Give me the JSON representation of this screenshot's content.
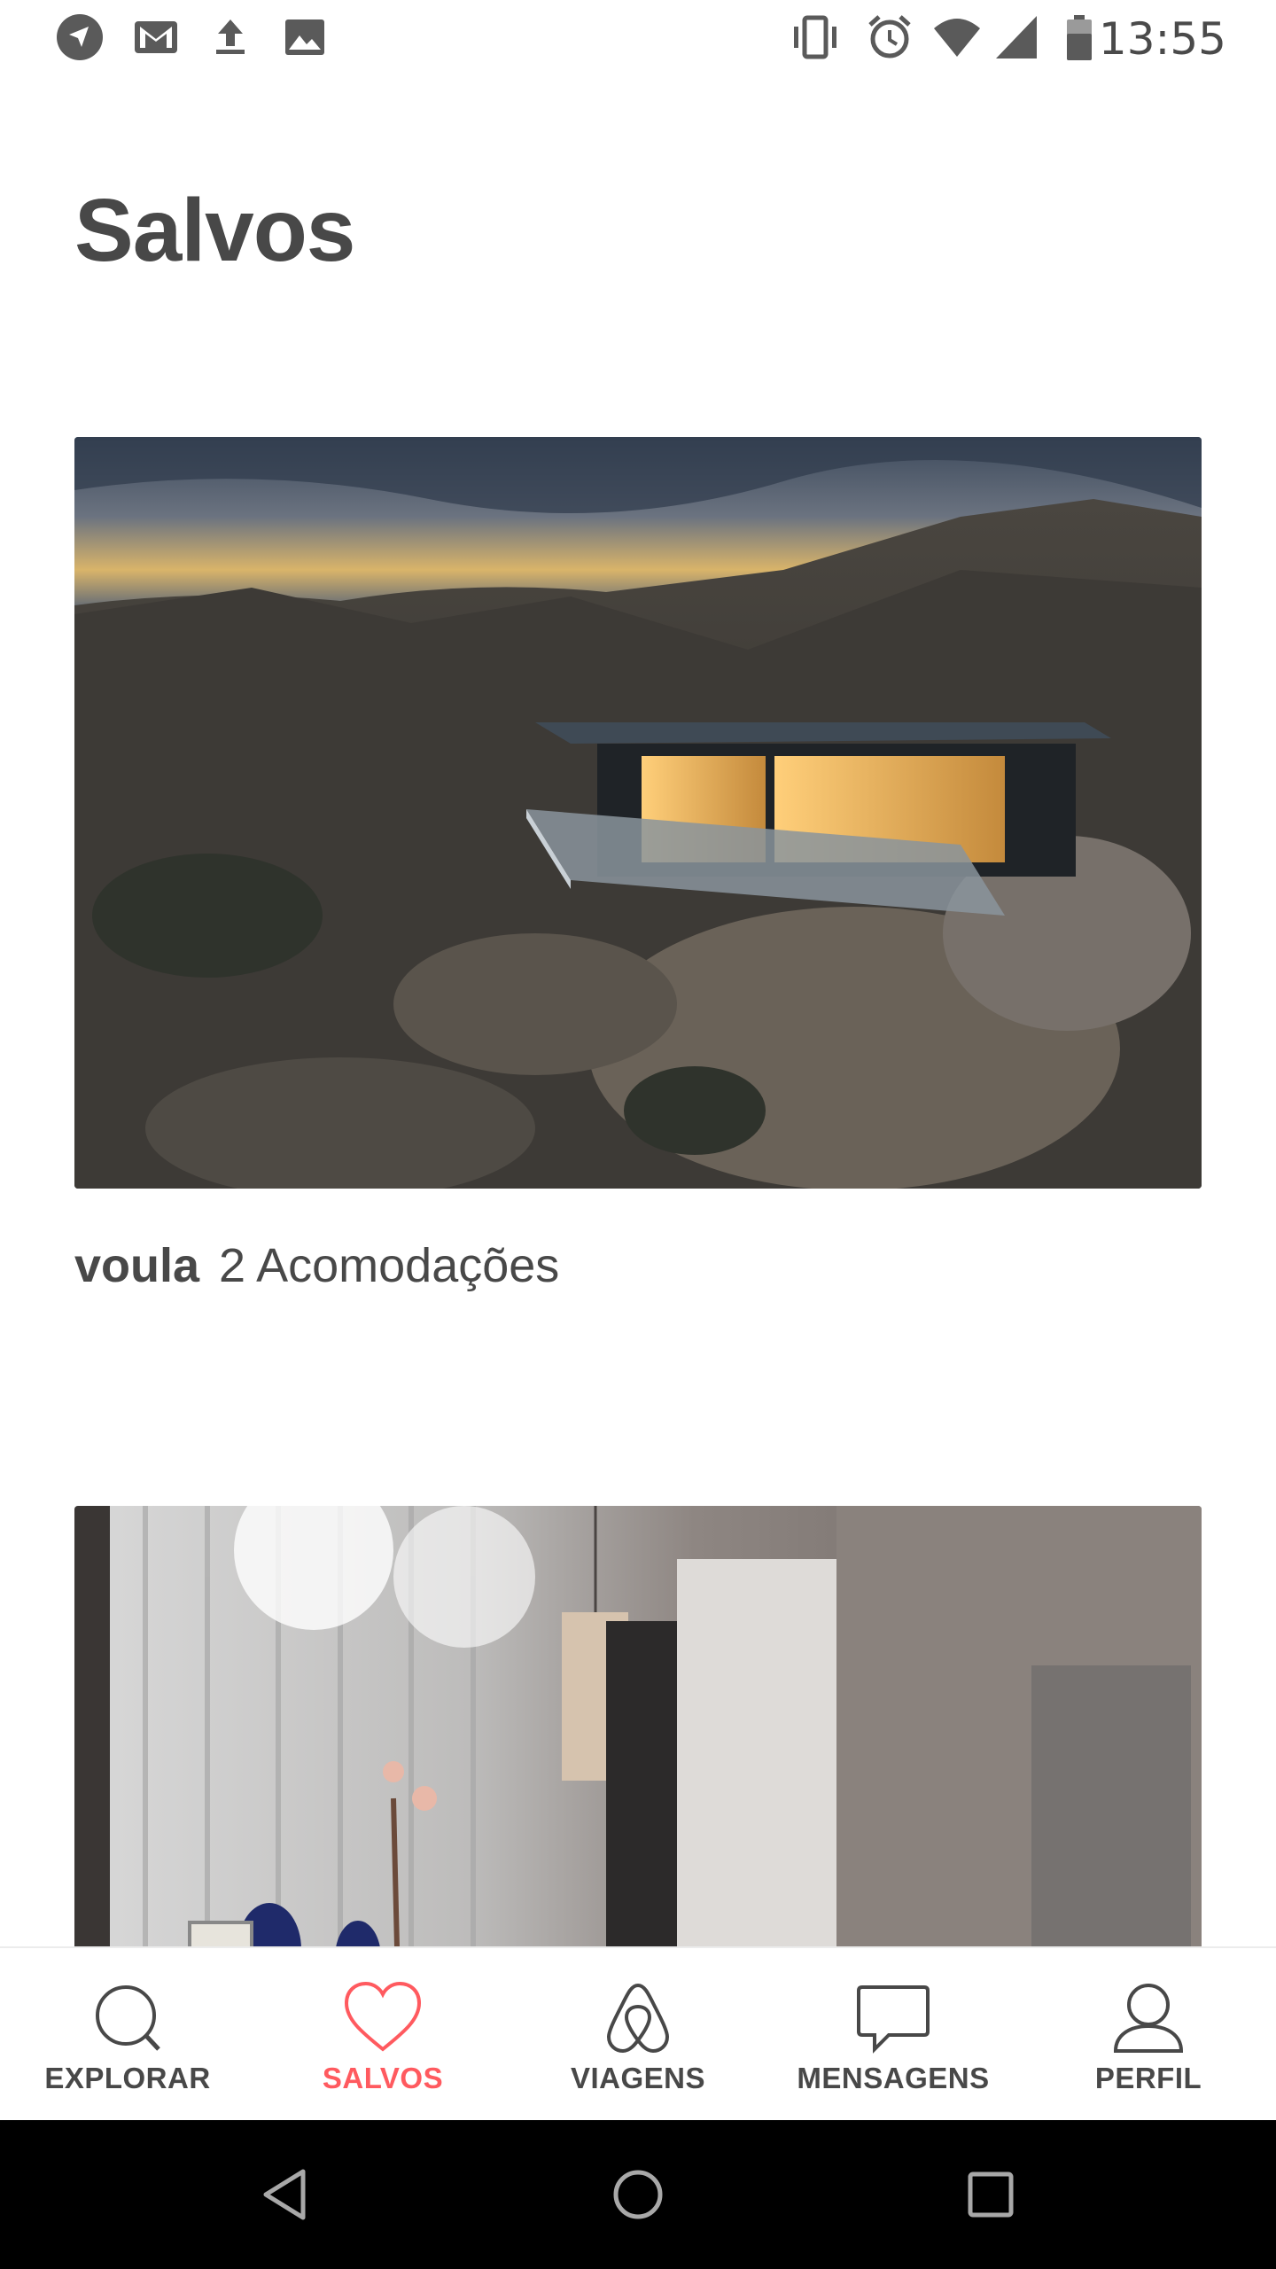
{
  "status_bar": {
    "time": "13:55",
    "left_icons": [
      "navigation-icon",
      "gmail-icon",
      "upload-icon",
      "image-icon"
    ],
    "right_icons": [
      "vibrate-icon",
      "alarm-icon",
      "wifi-icon",
      "signal-icon",
      "battery-icon"
    ]
  },
  "page": {
    "title": "Salvos"
  },
  "wishlists": [
    {
      "name": "voula",
      "count_text": "2 Acomodações",
      "image": "desert-house-photo"
    },
    {
      "name": "",
      "count_text": "",
      "image": "interior-room-photo"
    }
  ],
  "bottom_nav": {
    "items": [
      {
        "label": "EXPLORAR",
        "icon": "search-icon",
        "active": false
      },
      {
        "label": "SALVOS",
        "icon": "heart-icon",
        "active": true
      },
      {
        "label": "VIAGENS",
        "icon": "airbnb-logo-icon",
        "active": false
      },
      {
        "label": "MENSAGENS",
        "icon": "message-icon",
        "active": false
      },
      {
        "label": "PERFIL",
        "icon": "profile-icon",
        "active": false
      }
    ]
  },
  "system_nav": {
    "buttons": [
      "back-icon",
      "home-icon",
      "recents-icon"
    ]
  },
  "colors": {
    "accent": "#ff5a5f",
    "text": "#484848",
    "nav_bg": "#000000"
  }
}
